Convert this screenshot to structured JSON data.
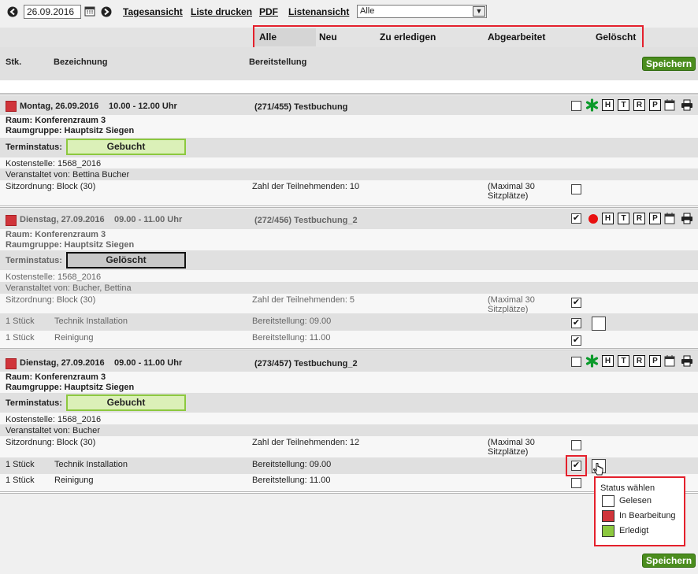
{
  "toolbar": {
    "date_value": "26.09.2016",
    "links": [
      "Tagesansicht",
      "Liste drucken",
      "PDF",
      "Listenansicht"
    ],
    "filter_selected": "Alle"
  },
  "tabs": [
    "Alle",
    "Neu",
    "Zu erledigen",
    "Abgearbeitet",
    "Gelöscht"
  ],
  "columns": {
    "qty": "Stk.",
    "name": "Bezeichnung",
    "provision": "Bereitstellung"
  },
  "save_label": "Speichern",
  "labels": {
    "terminstatus": "Terminstatus:",
    "popup_title": "Status wählen"
  },
  "bookings": [
    {
      "date": "Montag, 26.09.2016",
      "time": "10.00 - 12.00 Uhr",
      "ref": "(271/455) Testbuchung",
      "room": "Raum: Konferenzraum 3",
      "group": "Raumgruppe: Hauptsitz Siegen",
      "status": "Gebucht",
      "cost": "Kostenstelle: 1568_2016",
      "organizer": "Veranstaltet von: Bettina Bucher",
      "seating": "Sitzordnung: Block (30)",
      "participants": "Zahl der Teilnehmenden: 10",
      "max": "(Maximal 30 Sitzplätze)",
      "items": []
    },
    {
      "date": "Dienstag, 27.09.2016",
      "time": "09.00 - 11.00 Uhr",
      "ref": "(272/456) Testbuchung_2",
      "room": "Raum: Konferenzraum 3",
      "group": "Raumgruppe: Hauptsitz Siegen",
      "status": "Gelöscht",
      "cost": "Kostenstelle: 1568_2016",
      "organizer": "Veranstaltet von: Bucher, Bettina",
      "seating": "Sitzordnung: Block (30)",
      "participants": "Zahl der Teilnehmenden: 5",
      "max": "(Maximal 30 Sitzplätze)",
      "items": [
        {
          "qty": "1 Stück",
          "name": "Technik Installation",
          "provision": "Bereitstellung: 09.00"
        },
        {
          "qty": "1 Stück",
          "name": "Reinigung",
          "provision": "Bereitstellung: 11.00"
        }
      ]
    },
    {
      "date": "Dienstag, 27.09.2016",
      "time": "09.00 - 11.00 Uhr",
      "ref": "(273/457) Testbuchung_2",
      "room": "Raum: Konferenzraum 3",
      "group": "Raumgruppe: Hauptsitz Siegen",
      "status": "Gebucht",
      "cost": "Kostenstelle: 1568_2016",
      "organizer": "Veranstaltet von: Bucher",
      "seating": "Sitzordnung: Block (30)",
      "participants": "Zahl der Teilnehmenden: 12",
      "max": "(Maximal 30 Sitzplätze)",
      "items": [
        {
          "qty": "1 Stück",
          "name": "Technik Installation",
          "provision": "Bereitstellung: 09.00"
        },
        {
          "qty": "1 Stück",
          "name": "Reinigung",
          "provision": "Bereitstellung: 11.00"
        }
      ]
    }
  ],
  "action_icons": [
    "H",
    "T",
    "R",
    "P"
  ],
  "popup_options": [
    {
      "label": "Gelesen",
      "color": "#ffffff"
    },
    {
      "label": "In Bearbeitung",
      "color": "#d0343a"
    },
    {
      "label": "Erledigt",
      "color": "#8cc83f"
    }
  ],
  "colors": {
    "accent_red": "#e4202c",
    "save_green": "#4b8d1e",
    "booked_green": "#8cc83f",
    "status_red": "#d0343a"
  }
}
